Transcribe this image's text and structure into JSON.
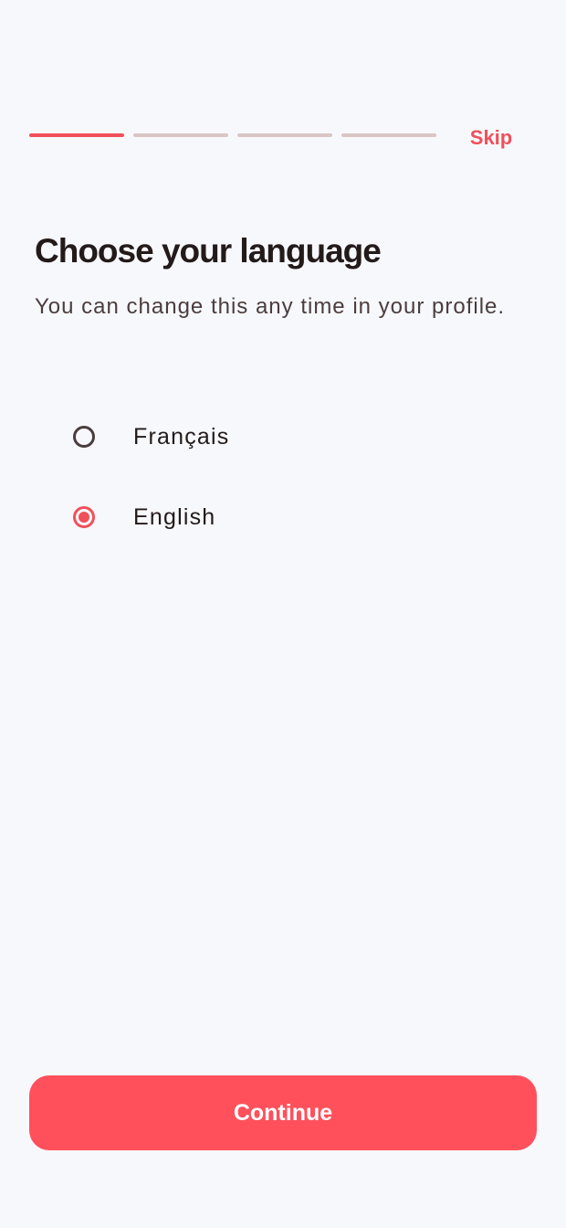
{
  "progress": {
    "total_steps": 4,
    "current_step": 1
  },
  "header": {
    "skip_label": "Skip"
  },
  "main": {
    "title": "Choose your language",
    "subtitle": "You can change this any time in your profile.",
    "options": [
      {
        "label": "Français",
        "selected": false
      },
      {
        "label": "English",
        "selected": true
      }
    ]
  },
  "footer": {
    "continue_label": "Continue"
  },
  "colors": {
    "accent": "#f0505b",
    "button": "#ff505c",
    "background": "#f7f8fb",
    "inactive_segment": "#d9c7c5"
  }
}
